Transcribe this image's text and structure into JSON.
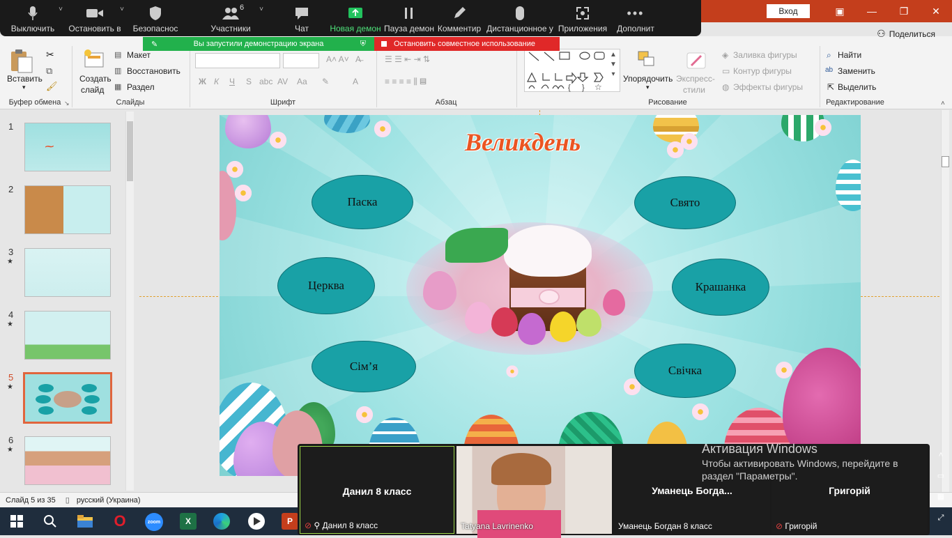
{
  "window": {
    "signin": "Вход",
    "share": "Поделиться",
    "minimize": "—",
    "restore": "❐",
    "close": "✕"
  },
  "zoom_toolbar": [
    {
      "label": "Выключить",
      "icon": "mic-icon"
    },
    {
      "label": "Остановить в",
      "icon": "video-camera-icon"
    },
    {
      "label": "Безопаснос",
      "icon": "shield-icon"
    },
    {
      "label": "Участники",
      "icon": "participants-icon",
      "badge": "6"
    },
    {
      "label": "Чат",
      "icon": "chat-icon"
    },
    {
      "label": "Новая демон",
      "icon": "share-screen-icon"
    },
    {
      "label": "Пауза демон",
      "icon": "pause-icon"
    },
    {
      "label": "Комментир",
      "icon": "pencil-icon"
    },
    {
      "label": "Дистанционное у",
      "icon": "mouse-icon"
    },
    {
      "label": "Приложения",
      "icon": "apps-icon"
    },
    {
      "label": "Дополнит",
      "icon": "more-icon"
    }
  ],
  "share_banner": {
    "active": "Вы запустили демонстрацию экрана",
    "stop": "Остановить совместное использование"
  },
  "ribbon": {
    "paste": "Вставить",
    "clipboard_label": "Буфер обмена",
    "new_slide_1": "Создать",
    "new_slide_2": "слайд",
    "layout": "Макет",
    "reset": "Восстановить",
    "section": "Раздел",
    "slides_label": "Слайды",
    "font_label": "Шрифт",
    "paragraph_label": "Абзац",
    "arrange": "Упорядочить",
    "quick_styles_1": "Экспресс-",
    "quick_styles_2": "стили",
    "shape_fill": "Заливка фигуры",
    "shape_outline": "Контур фигуры",
    "shape_effects": "Эффекты фигуры",
    "drawing_label": "Рисование",
    "find": "Найти",
    "replace": "Заменить",
    "select": "Выделить",
    "editing_label": "Редактирование",
    "font_bold": "Ж",
    "font_italic": "К",
    "font_underline": "Ч",
    "font_strike": "S",
    "font_case": "Aa"
  },
  "thumbnails": [
    {
      "num": "1",
      "star": ""
    },
    {
      "num": "2",
      "star": ""
    },
    {
      "num": "3",
      "star": "★"
    },
    {
      "num": "4",
      "star": "★"
    },
    {
      "num": "5",
      "star": "★"
    },
    {
      "num": "6",
      "star": "★"
    }
  ],
  "slide": {
    "title": "Великдень",
    "ovals": [
      "Паска",
      "Свято",
      "Церква",
      "Крашанка",
      "Сім’я",
      "Свічка"
    ]
  },
  "statusbar": {
    "slide_info": "Слайд 5 из 35",
    "language": "русский (Украина)"
  },
  "video_tiles": [
    {
      "name": "Данил 8 класс",
      "sub": "Данил 8 класс"
    },
    {
      "name": "",
      "sub": "Tatyana Lavrinenko"
    },
    {
      "name": "Уманець  Богда...",
      "sub": "Уманець Богдан 8 класс"
    },
    {
      "name": "Григорій",
      "sub": "Григорій"
    }
  ],
  "windows_activation": {
    "title": "Активация Windows",
    "line1": "Чтобы активировать Windows, перейдите в",
    "line2": "раздел \"Параметры\"."
  },
  "taskbar": {
    "zoom_label": "zoom",
    "excel_label": "X",
    "powerpoint_label": "P",
    "opera_label": "O"
  }
}
